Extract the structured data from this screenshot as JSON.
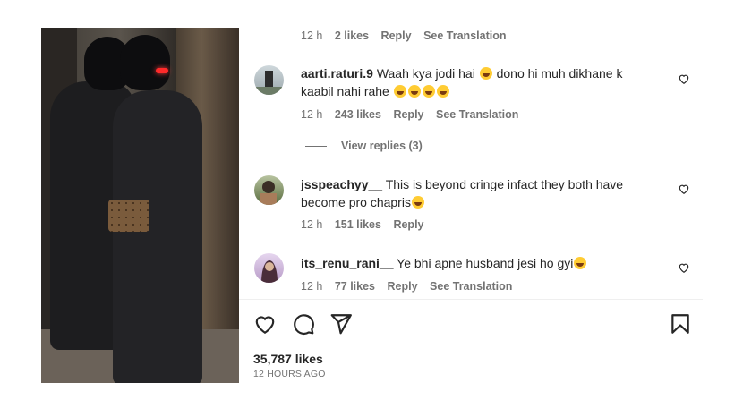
{
  "comments": [
    {
      "meta": {
        "time": "12 h",
        "likes": "2 likes",
        "reply": "Reply",
        "translation": "See Translation"
      }
    },
    {
      "user": "aarti.raturi.9",
      "text_a": "Waah kya jodi hai",
      "text_b": "dono hi muh dikhane k",
      "text_c": "kaabil nahi rahe",
      "meta": {
        "time": "12 h",
        "likes": "243 likes",
        "reply": "Reply",
        "translation": "See Translation"
      },
      "view_replies": "View replies (3)"
    },
    {
      "user": "jsspeachyy__",
      "text_a": "This is beyond cringe infact they both have",
      "text_b": "become pro chapris",
      "meta": {
        "time": "12 h",
        "likes": "151 likes",
        "reply": "Reply"
      }
    },
    {
      "user": "its_renu_rani__",
      "text_a": "Ye bhi apne husband jesi ho gyi",
      "meta": {
        "time": "12 h",
        "likes": "77 likes",
        "reply": "Reply",
        "translation": "See Translation"
      }
    }
  ],
  "post": {
    "likes": "35,787 likes",
    "time": "12 HOURS AGO"
  },
  "icons": [
    "heart-icon",
    "comment-icon",
    "share-icon",
    "bookmark-icon"
  ]
}
